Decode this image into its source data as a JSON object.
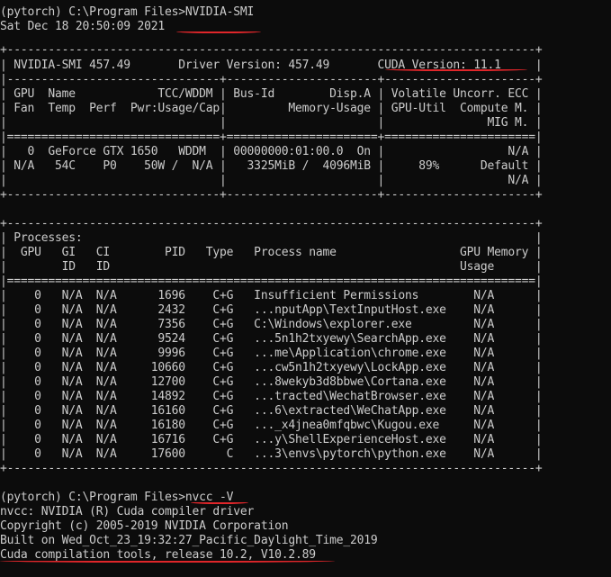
{
  "terminal": {
    "lines": [
      "(pytorch) C:\\Program Files>NVIDIA-SMI",
      "Sat Dec 18 20:50:09 2021",
      "+-----------------------------------------------------------------------------+",
      "| NVIDIA-SMI 457.49       Driver Version: 457.49       CUDA Version: 11.1     |",
      "|-------------------------------+----------------------+----------------------+",
      "| GPU  Name            TCC/WDDM | Bus-Id        Disp.A | Volatile Uncorr. ECC |",
      "| Fan  Temp  Perf  Pwr:Usage/Cap|         Memory-Usage | GPU-Util  Compute M. |",
      "|                               |                      |               MIG M. |",
      "|===============================+======================+======================|",
      "|   0  GeForce GTX 1650   WDDM  | 00000000:01:00.0  On |                  N/A |",
      "| N/A   54C    P0    50W /  N/A |   3325MiB /  4096MiB |     89%      Default |",
      "|                               |                      |                  N/A |",
      "+-------------------------------+----------------------+----------------------+",
      "",
      "+-----------------------------------------------------------------------------+",
      "| Processes:                                                                  |",
      "|  GPU   GI   CI        PID   Type   Process name                  GPU Memory |",
      "|        ID   ID                                                   Usage      |",
      "|=============================================================================|",
      "|    0   N/A  N/A      1696    C+G   Insufficient Permissions        N/A      |",
      "|    0   N/A  N/A      2432    C+G   ...nputApp\\TextInputHost.exe    N/A      |",
      "|    0   N/A  N/A      7356    C+G   C:\\Windows\\explorer.exe         N/A      |",
      "|    0   N/A  N/A      9524    C+G   ...5n1h2txyewy\\SearchApp.exe    N/A      |",
      "|    0   N/A  N/A      9996    C+G   ...me\\Application\\chrome.exe    N/A      |",
      "|    0   N/A  N/A     10660    C+G   ...cw5n1h2txyewy\\LockApp.exe    N/A      |",
      "|    0   N/A  N/A     12700    C+G   ...8wekyb3d8bbwe\\Cortana.exe    N/A      |",
      "|    0   N/A  N/A     14892    C+G   ...tracted\\WechatBrowser.exe    N/A      |",
      "|    0   N/A  N/A     16160    C+G   ...6\\extracted\\WeChatApp.exe    N/A      |",
      "|    0   N/A  N/A     16180    C+G   ..._x4jnea0mfqbwc\\Kugou.exe     N/A      |",
      "|    0   N/A  N/A     16716    C+G   ...y\\ShellExperienceHost.exe    N/A      |",
      "|    0   N/A  N/A     17600      C   ...3\\envs\\pytorch\\python.exe    N/A      |",
      "+-----------------------------------------------------------------------------+",
      "",
      "(pytorch) C:\\Program Files>nvcc -V",
      "nvcc: NVIDIA (R) Cuda compiler driver",
      "Copyright (c) 2005-2019 NVIDIA Corporation",
      "Built on Wed_Oct_23_19:32:27_Pacific_Daylight_Time_2019",
      "Cuda compilation tools, release 10.2, V10.2.89"
    ]
  }
}
